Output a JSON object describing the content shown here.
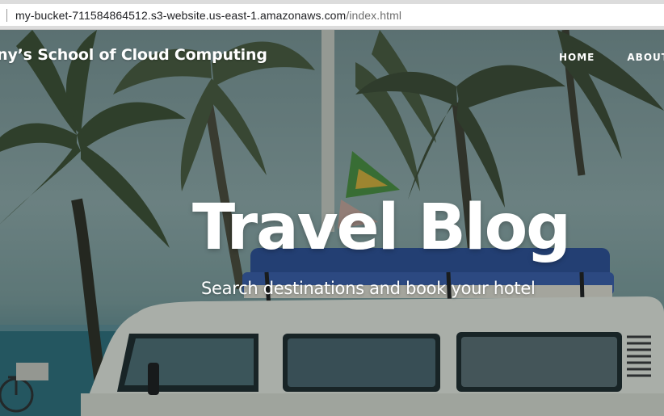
{
  "browser": {
    "url_host": "my-bucket-711584864512.s3-website.us-east-1.amazonaws.com",
    "url_path": "/index.html"
  },
  "site": {
    "brand": "Sunny’s School of Cloud Computing",
    "nav": [
      {
        "label": "HOME",
        "icon": "none"
      },
      {
        "label": "ABOUT",
        "icon": "none"
      }
    ]
  },
  "hero": {
    "title": "Travel Blog",
    "subtitle": "Search destinations and book your hotel",
    "background_image": "palm-trees-beach-camper-van-photo",
    "colors": {
      "sky": "#90aaa9",
      "sea": "#2f6f7c",
      "van": "#e6e9e0",
      "text": "#ffffff"
    }
  }
}
